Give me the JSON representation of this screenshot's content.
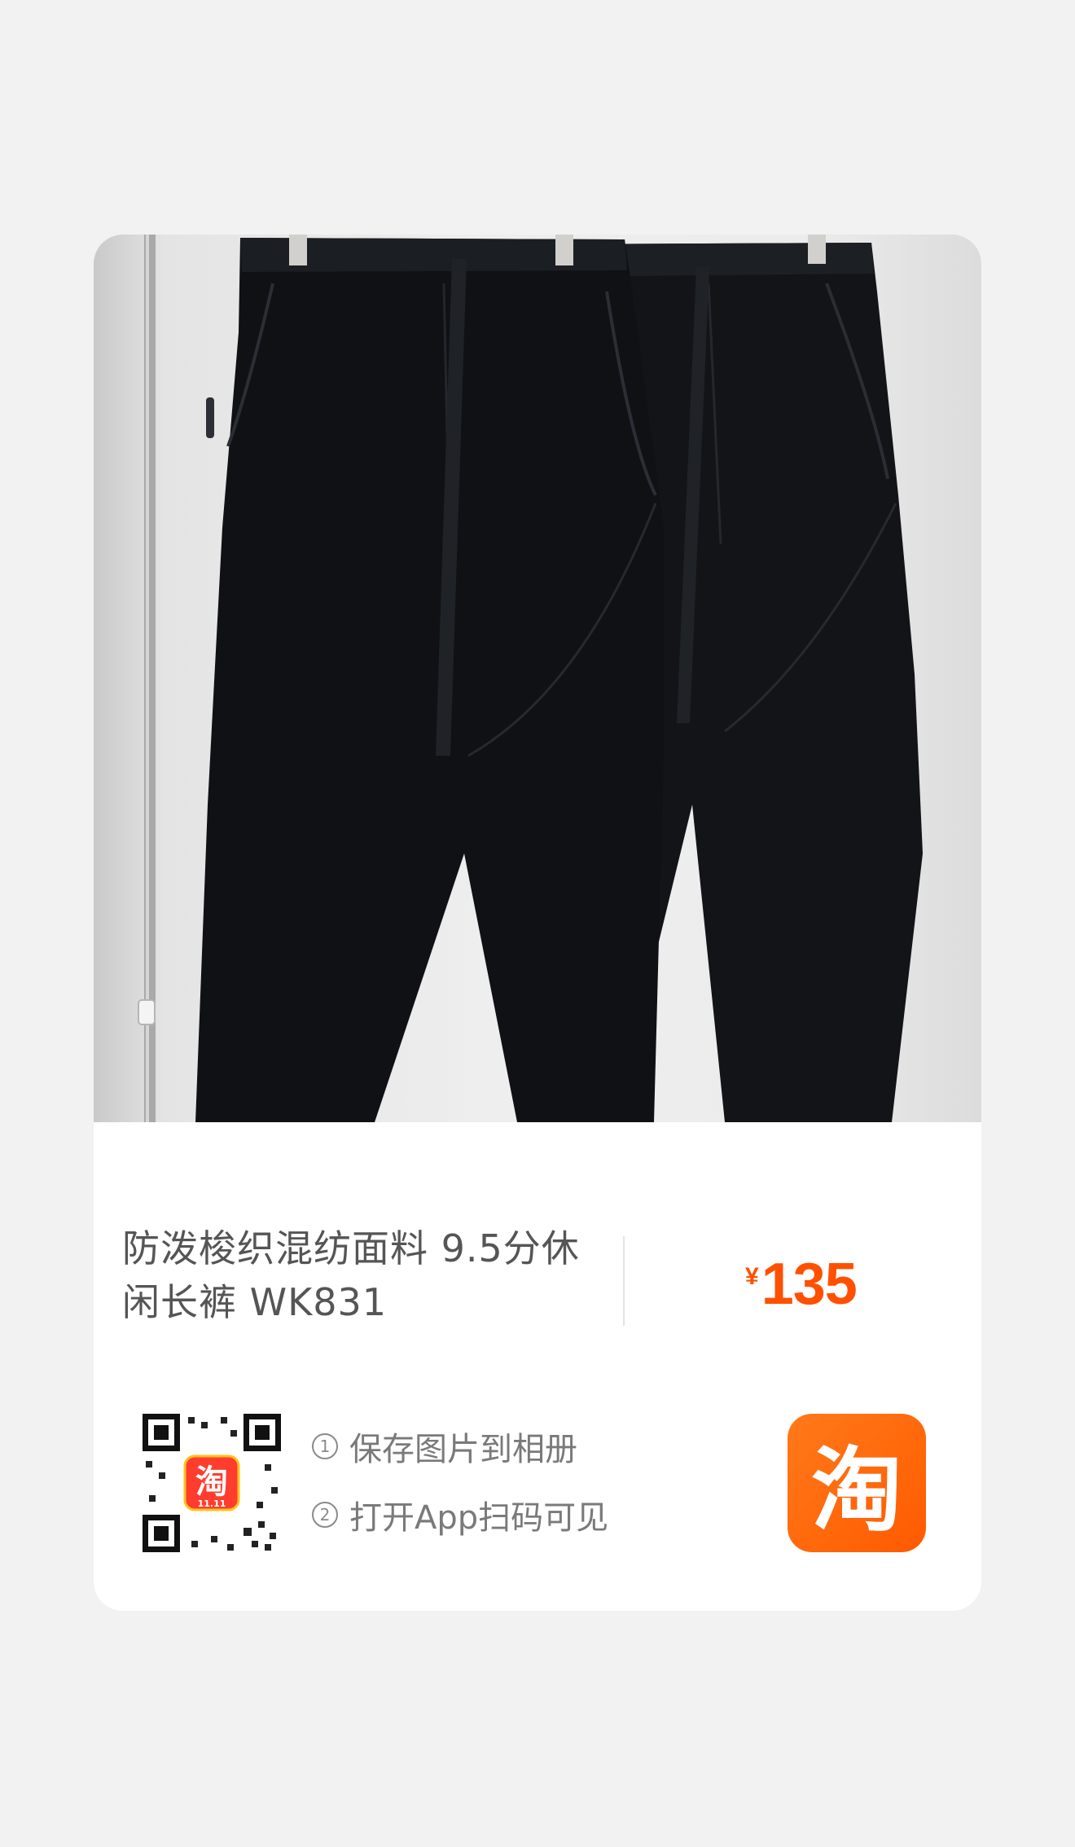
{
  "product": {
    "title": "防泼梭织混纺面料 9.5分休闲长裤 WK831",
    "currency": "¥",
    "price": "135"
  },
  "share": {
    "step1_num": "1",
    "step1_text": "保存图片到相册",
    "step2_num": "2",
    "step2_text": "打开App扫码可见",
    "qr_badge_text": "淘",
    "qr_badge_sub": "11.11",
    "logo_char": "淘"
  },
  "colors": {
    "price": "#ff5000",
    "logo": "#ff5a00",
    "page_bg": "#f2f2f2"
  },
  "icons": [
    "qr-code-icon",
    "taobao-logo-icon"
  ]
}
